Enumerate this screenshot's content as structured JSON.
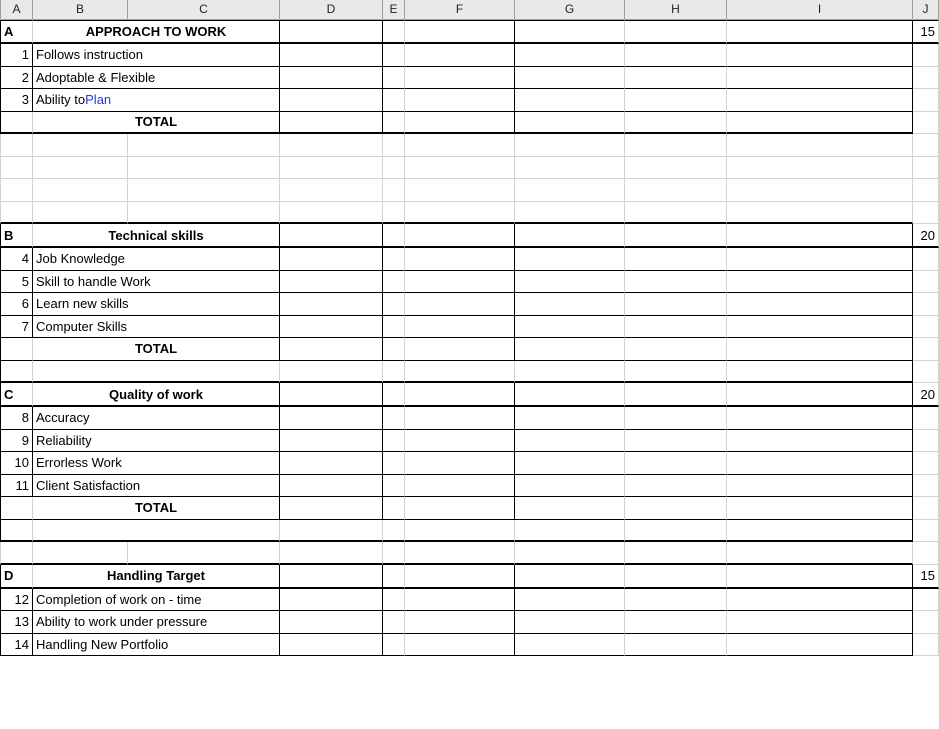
{
  "columnHeaders": [
    "A",
    "B",
    "C",
    "D",
    "E",
    "F",
    "G",
    "H",
    "I",
    "J"
  ],
  "sections": {
    "a": {
      "letter": "A",
      "title": "APPROACH TO WORK",
      "score": "15"
    },
    "b": {
      "letter": "B",
      "title": "Technical skills",
      "score": "20"
    },
    "c": {
      "letter": "C",
      "title": "Quality of work",
      "score": "20"
    },
    "d": {
      "letter": "D",
      "title": "Handling Target",
      "score": "15"
    }
  },
  "items": {
    "a1": {
      "n": "1",
      "label": "Follows instruction"
    },
    "a2": {
      "n": "2",
      "label": "Adoptable & Flexible"
    },
    "a3": {
      "n": "3",
      "label_prefix": "Ability to ",
      "label_link": "Plan"
    },
    "b1": {
      "n": "4",
      "label": "Job Knowledge"
    },
    "b2": {
      "n": "5",
      "label": "Skill to handle Work"
    },
    "b3": {
      "n": "6",
      "label": "Learn new skills"
    },
    "b4": {
      "n": "7",
      "label": "Computer Skills"
    },
    "c1": {
      "n": "8",
      "label": "Accuracy"
    },
    "c2": {
      "n": "9",
      "label": "Reliability"
    },
    "c3": {
      "n": "10",
      "label": "Errorless Work"
    },
    "c4": {
      "n": "11",
      "label": "Client Satisfaction"
    },
    "d1": {
      "n": "12",
      "label": "Completion  of work on - time"
    },
    "d2": {
      "n": "13",
      "label": "Ability to work under pressure"
    },
    "d3": {
      "n": "14",
      "label": "Handling New Portfolio"
    }
  },
  "labels": {
    "total": "TOTAL"
  }
}
